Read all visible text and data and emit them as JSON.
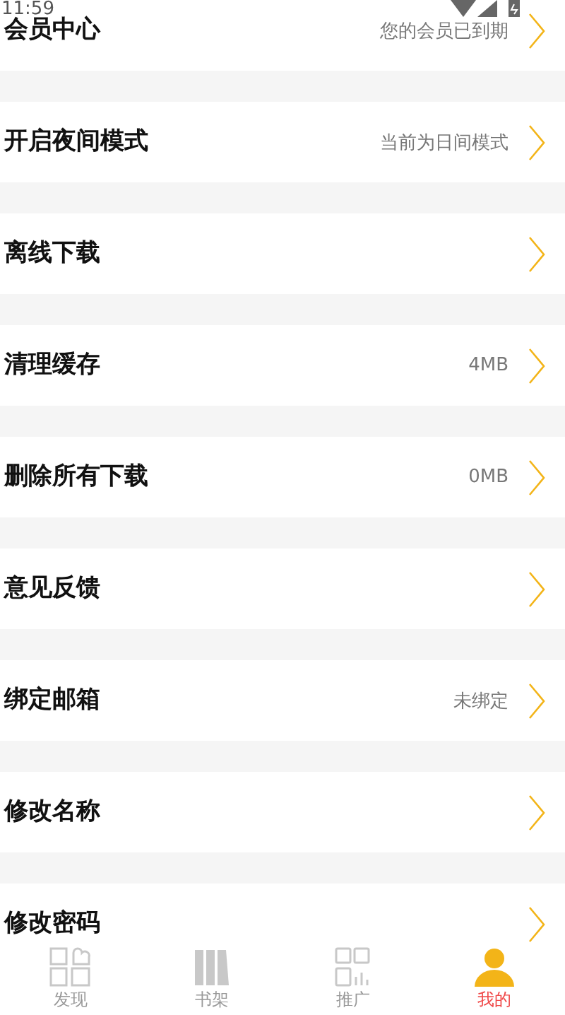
{
  "status_bar": {
    "time": "11:59"
  },
  "settings": [
    {
      "label": "会员中心",
      "value": "您的会员已到期"
    },
    {
      "label": "开启夜间模式",
      "value": "当前为日间模式"
    },
    {
      "label": "离线下载"
    },
    {
      "label": "清理缓存",
      "value": "4MB"
    },
    {
      "label": "删除所有下载",
      "value": "0MB"
    },
    {
      "label": "意见反馈"
    },
    {
      "label": "绑定邮箱",
      "value": "未绑定"
    },
    {
      "label": "修改名称"
    },
    {
      "label": "修改密码"
    }
  ],
  "tabs": [
    {
      "label": "发现",
      "kind": "discover",
      "selected": false
    },
    {
      "label": "书架",
      "kind": "shelf",
      "selected": false
    },
    {
      "label": "推广",
      "kind": "promo",
      "selected": false
    },
    {
      "label": "我的",
      "kind": "me",
      "selected": true
    }
  ]
}
